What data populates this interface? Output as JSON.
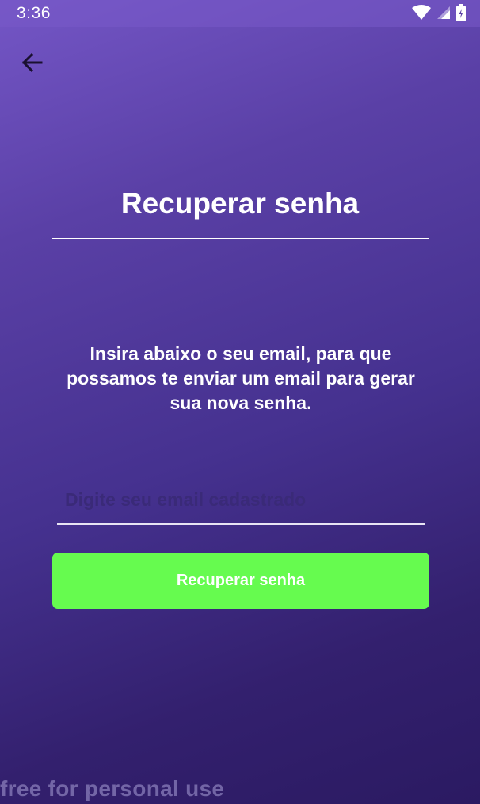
{
  "status_bar": {
    "time": "3:36",
    "icons": [
      "wifi-icon",
      "signal-icon",
      "battery-icon"
    ]
  },
  "nav": {
    "back_icon": "arrow-left-icon"
  },
  "page": {
    "title": "Recuperar senha",
    "instructions": "Insira abaixo o seu email, para que possamos te enviar um email para gerar sua nova senha."
  },
  "form": {
    "email_placeholder": "Digite seu email cadastrado",
    "email_value": "",
    "submit_label": "Recuperar senha"
  },
  "watermark": "free for personal use",
  "colors": {
    "background_top": "#7456c6",
    "background_bottom": "#2b1a62",
    "accent_button": "#66fb4f",
    "placeholder": "#3a2a78",
    "text": "#ffffff"
  }
}
